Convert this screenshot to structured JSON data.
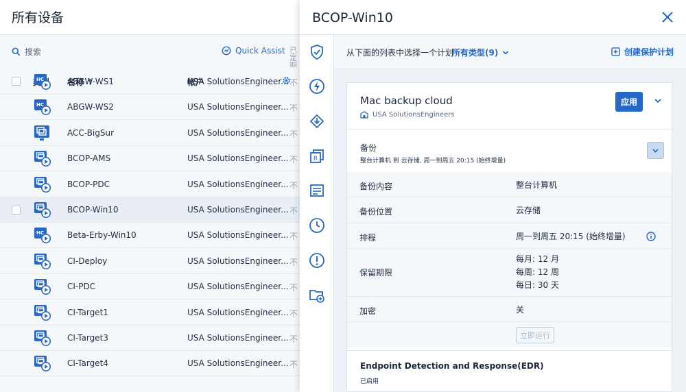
{
  "list": {
    "title": "所有设备",
    "search_placeholder": "搜索",
    "quick_assist": "Quick Assist",
    "extra_col": "已定期",
    "columns": {
      "type": "类型",
      "name": "名称",
      "sort_indicator": "↑",
      "account": "帐户"
    },
    "rows": [
      {
        "name": "ABGW-WS1",
        "account": "USA SolutionsEngineer...",
        "trunc": "不",
        "icon": "hc-vm-icon",
        "selected": false
      },
      {
        "name": "ABGW-WS2",
        "account": "USA SolutionsEngineer...",
        "trunc": "不",
        "icon": "hc-vm-icon",
        "selected": false
      },
      {
        "name": "ACC-BigSur",
        "account": "USA SolutionsEngineer...",
        "trunc": "不",
        "icon": "mac-machine-icon",
        "selected": false
      },
      {
        "name": "BCOP-AMS",
        "account": "USA SolutionsEngineer...",
        "trunc": "不",
        "icon": "vm-icon",
        "selected": false
      },
      {
        "name": "BCOP-PDC",
        "account": "USA SolutionsEngineer...",
        "trunc": "不",
        "icon": "vm-icon",
        "selected": false
      },
      {
        "name": "BCOP-Win10",
        "account": "USA SolutionsEngineer...",
        "trunc": "不",
        "icon": "vm-icon",
        "selected": true
      },
      {
        "name": "Beta-Erby-Win10",
        "account": "USA SolutionsEngineer...",
        "trunc": "不",
        "icon": "hc-vm-icon",
        "selected": false
      },
      {
        "name": "CI-Deploy",
        "account": "USA SolutionsEngineer...",
        "trunc": "不",
        "icon": "vm-icon",
        "selected": false
      },
      {
        "name": "CI-PDC",
        "account": "USA SolutionsEngineer...",
        "trunc": "不",
        "icon": "vm-icon",
        "selected": false
      },
      {
        "name": "CI-Target1",
        "account": "USA SolutionsEngineer...",
        "trunc": "不",
        "icon": "vm-icon",
        "selected": false
      },
      {
        "name": "CI-Target3",
        "account": "USA SolutionsEngineer...",
        "trunc": "不",
        "icon": "vm-icon",
        "selected": false
      },
      {
        "name": "CI-Target4",
        "account": "USA SolutionsEngineer...",
        "trunc": "不",
        "icon": "vm-icon",
        "selected": false
      }
    ]
  },
  "panel": {
    "title": "BCOP-Win10",
    "toolbar": {
      "hint": "从下面的列表中选择一个计划",
      "types": "所有类型(9)",
      "create": "创建保护计划"
    },
    "plan": {
      "name": "Mac backup cloud",
      "account": "USA SolutionsEngineers",
      "apply": "应用"
    },
    "backup": {
      "title": "备份",
      "subtitle": "整台计算机 到 云存储, 周一到周五 20:15 (始终增量)",
      "rows": [
        {
          "key": "备份内容",
          "value": "整台计算机"
        },
        {
          "key": "备份位置",
          "value": "云存储"
        },
        {
          "key": "排程",
          "value": "周一到周五 20:15 (始终增量)"
        },
        {
          "key": "保留期限",
          "value_lines": [
            "每月: 12 月",
            "每周: 12 周",
            "每日: 30 天"
          ]
        },
        {
          "key": "加密",
          "value": "关"
        }
      ],
      "run_now": "立即运行"
    },
    "edr": {
      "title": "Endpoint Detection and Response(EDR)",
      "status": "已启用"
    }
  },
  "colors": {
    "accent": "#2668c5",
    "text": "#243143",
    "bg": "#f5f8fb"
  }
}
